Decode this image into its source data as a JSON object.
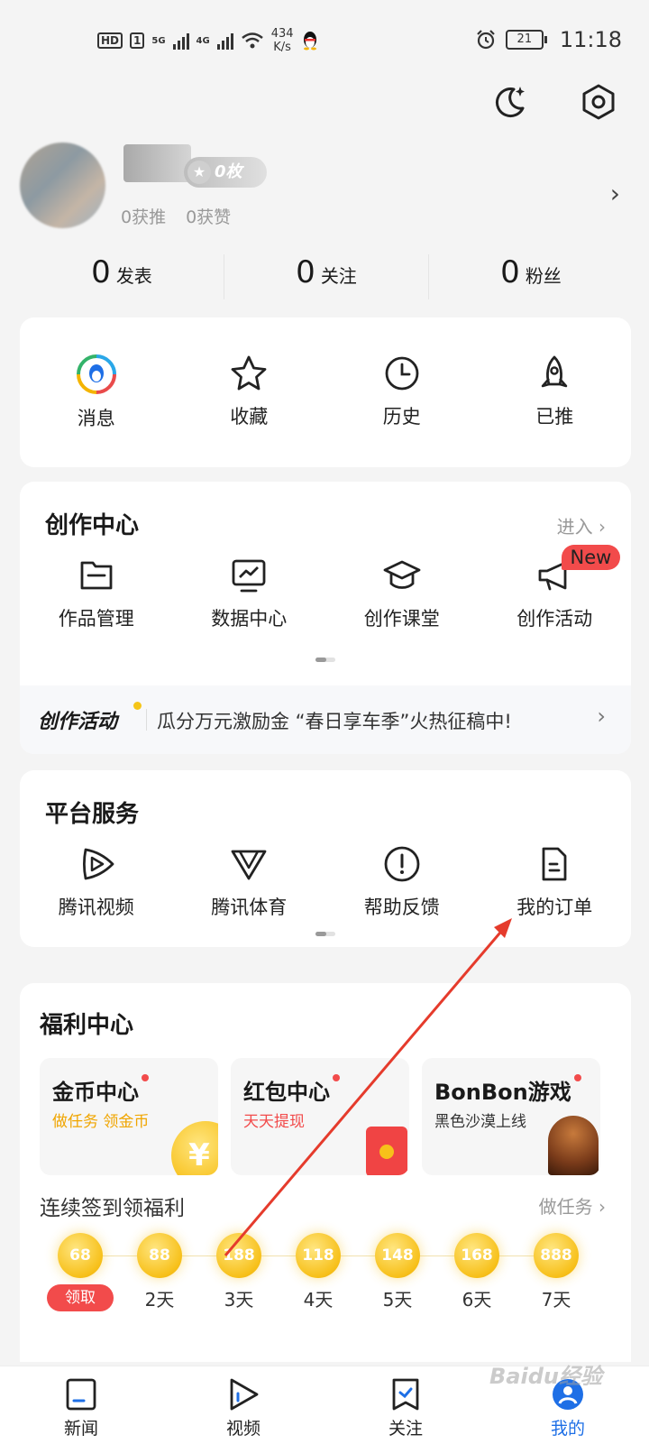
{
  "status_bar": {
    "hd": "HD",
    "sim": "1",
    "net1": "5G",
    "net2": "4G",
    "speed_value": "434",
    "speed_unit": "K/s",
    "battery": "21",
    "time": "11:18"
  },
  "profile": {
    "coin_badge": "0枚",
    "recommended": "0获推",
    "likes": "0获赞"
  },
  "counts": [
    {
      "num": "0",
      "label": "发表"
    },
    {
      "num": "0",
      "label": "关注"
    },
    {
      "num": "0",
      "label": "粉丝"
    }
  ],
  "quick": [
    {
      "label": "消息",
      "icon": "qq-message-icon"
    },
    {
      "label": "收藏",
      "icon": "star-icon"
    },
    {
      "label": "历史",
      "icon": "clock-icon"
    },
    {
      "label": "已推",
      "icon": "rocket-icon"
    }
  ],
  "creation": {
    "title": "创作中心",
    "enter": "进入",
    "items": [
      {
        "label": "作品管理",
        "icon": "folder-icon"
      },
      {
        "label": "数据中心",
        "icon": "chart-monitor-icon"
      },
      {
        "label": "创作课堂",
        "icon": "graduation-cap-icon"
      },
      {
        "label": "创作活动",
        "icon": "megaphone-icon"
      }
    ],
    "new_tag": "New",
    "banner_tag": "创作活动",
    "banner_text": "瓜分万元激励金 “春日享车季”火热征稿中!"
  },
  "platform": {
    "title": "平台服务",
    "items": [
      {
        "label": "腾讯视频",
        "icon": "tencent-video-icon"
      },
      {
        "label": "腾讯体育",
        "icon": "tencent-sports-icon"
      },
      {
        "label": "帮助反馈",
        "icon": "exclamation-circle-icon"
      },
      {
        "label": "我的订单",
        "icon": "order-document-icon"
      }
    ]
  },
  "welfare": {
    "title": "福利中心",
    "tiles": [
      {
        "title": "金币中心",
        "desc": "做任务 领金币",
        "desc_color": "#f0a500"
      },
      {
        "title": "红包中心",
        "desc": "天天提现",
        "desc_color": "#f24b4b"
      },
      {
        "title": "BonBon游戏",
        "desc": "黑色沙漠上线",
        "desc_color": "#333333"
      }
    ],
    "coin_symbol": "¥",
    "signin_title": "连续签到领福利",
    "do_task": "做任务",
    "days": [
      {
        "coins": "68",
        "label": "领取"
      },
      {
        "coins": "88",
        "label": "2天"
      },
      {
        "coins": "188",
        "label": "3天"
      },
      {
        "coins": "118",
        "label": "4天"
      },
      {
        "coins": "148",
        "label": "5天"
      },
      {
        "coins": "168",
        "label": "6天"
      },
      {
        "coins": "888",
        "label": "7天"
      }
    ]
  },
  "tabs": [
    {
      "label": "新闻",
      "icon": "news-icon"
    },
    {
      "label": "视频",
      "icon": "video-play-icon"
    },
    {
      "label": "关注",
      "icon": "follow-icon"
    },
    {
      "label": "我的",
      "icon": "profile-icon",
      "active": true
    }
  ],
  "accent_color": "#1e6fe6",
  "watermark": "Baidu经验"
}
